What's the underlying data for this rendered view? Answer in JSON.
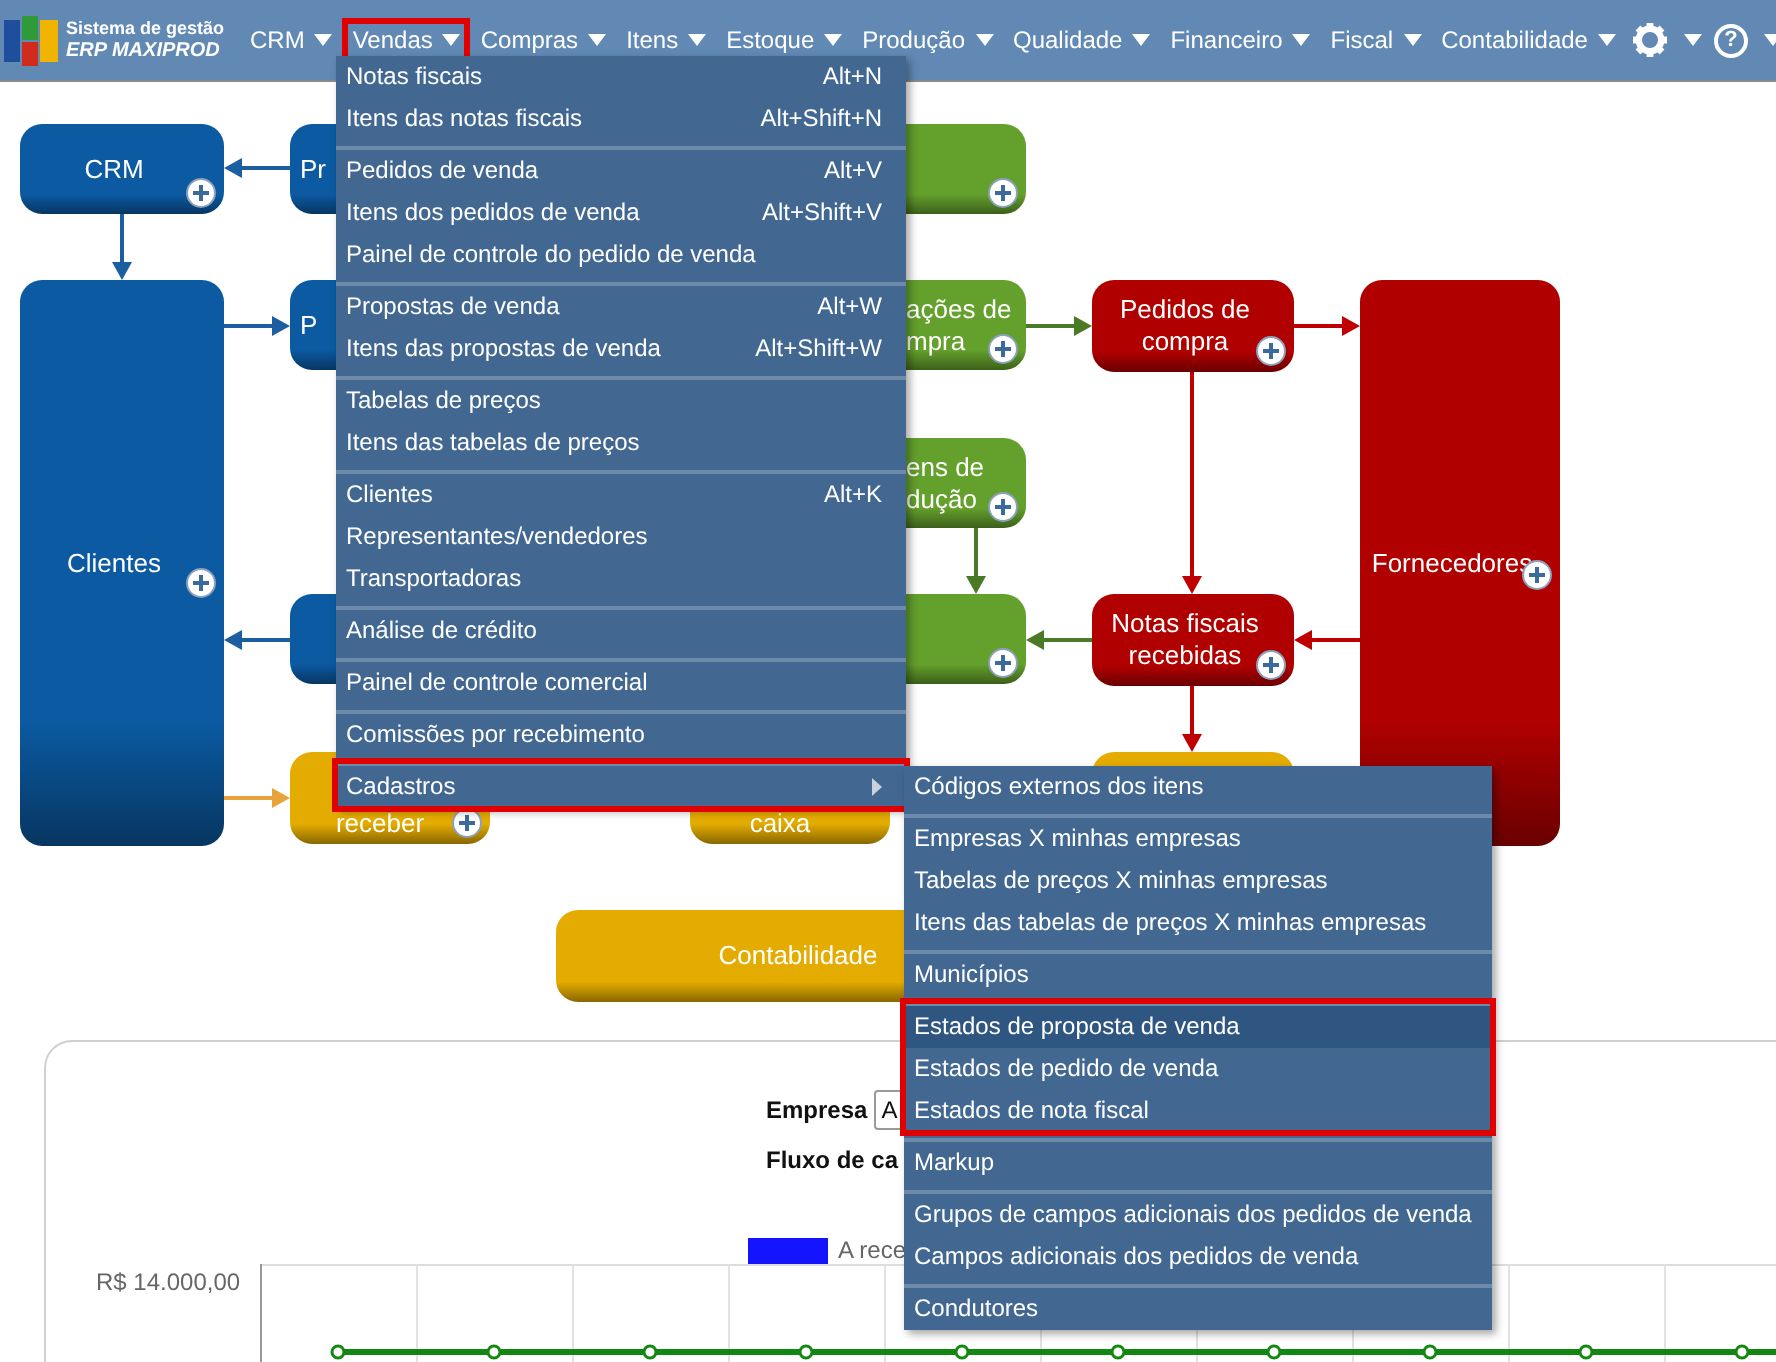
{
  "header": {
    "logo_line1": "Sistema de gestão",
    "logo_line2": "ERP MAXIPROD",
    "help_glyph": "?",
    "nav": [
      {
        "label": "CRM",
        "highlighted": false
      },
      {
        "label": "Vendas",
        "highlighted": true
      },
      {
        "label": "Compras",
        "highlighted": false
      },
      {
        "label": "Itens",
        "highlighted": false
      },
      {
        "label": "Estoque",
        "highlighted": false
      },
      {
        "label": "Produção",
        "highlighted": false
      },
      {
        "label": "Qualidade",
        "highlighted": false
      },
      {
        "label": "Financeiro",
        "highlighted": false
      },
      {
        "label": "Fiscal",
        "highlighted": false
      },
      {
        "label": "Contabilidade",
        "highlighted": false
      }
    ]
  },
  "flow_nodes": [
    {
      "lines": [
        "CRM"
      ],
      "color": "#0b5aa2",
      "has_add": true
    },
    {
      "lines": [
        "Pr"
      ],
      "color": "#0b5aa2",
      "has_add": false
    },
    {
      "color": "#64a02c",
      "has_add": true
    },
    {
      "lines": [
        "Clientes"
      ],
      "color": "#0b5aa2",
      "has_add": true
    },
    {
      "lines": [
        "P"
      ],
      "color": "#0b5aa2",
      "has_add": false
    },
    {
      "lines": [
        "ações de",
        "mpra"
      ],
      "color": "#64a02c",
      "has_add": true
    },
    {
      "lines": [
        "Pedidos de",
        "compra"
      ],
      "color": "#b00000",
      "has_add": true
    },
    {
      "lines": [
        "Fornecedores"
      ],
      "color": "#b00000",
      "has_add": true
    },
    {
      "lines": [
        "ens de",
        "dução"
      ],
      "color": "#64a02c",
      "has_add": true
    },
    {
      "color": "#0b5aa2",
      "has_add": false
    },
    {
      "color": "#64a02c",
      "has_add": true
    },
    {
      "lines": [
        "Notas fiscais",
        "recebidas"
      ],
      "color": "#b00000",
      "has_add": true
    },
    {
      "lines": [
        "receber"
      ],
      "color": "#e4ac00",
      "has_add": true
    },
    {
      "lines": [
        "caixa"
      ],
      "color": "#e4ac00",
      "has_add": false
    },
    {
      "color": "#e4ac00",
      "has_add": false
    },
    {
      "lines": [
        "Contabilidade"
      ],
      "color": "#e4ac00",
      "has_add": false
    }
  ],
  "vendas_menu": {
    "groups": [
      {
        "highlighted": false,
        "items": [
          {
            "label": "Notas fiscais",
            "shortcut": "Alt+N",
            "has_submenu": false
          },
          {
            "label": "Itens das notas fiscais",
            "shortcut": "Alt+Shift+N",
            "has_submenu": false
          }
        ]
      },
      {
        "highlighted": false,
        "items": [
          {
            "label": "Pedidos de venda",
            "shortcut": "Alt+V",
            "has_submenu": false
          },
          {
            "label": "Itens dos pedidos de venda",
            "shortcut": "Alt+Shift+V",
            "has_submenu": false
          },
          {
            "label": "Painel de controle do pedido de venda",
            "has_submenu": false
          }
        ]
      },
      {
        "highlighted": false,
        "items": [
          {
            "label": "Propostas de venda",
            "shortcut": "Alt+W",
            "has_submenu": false
          },
          {
            "label": "Itens das propostas de venda",
            "shortcut": "Alt+Shift+W",
            "has_submenu": false
          }
        ]
      },
      {
        "highlighted": false,
        "items": [
          {
            "label": "Tabelas de preços",
            "has_submenu": false
          },
          {
            "label": "Itens das tabelas de preços",
            "has_submenu": false
          }
        ]
      },
      {
        "highlighted": false,
        "items": [
          {
            "label": "Clientes",
            "shortcut": "Alt+K",
            "has_submenu": false
          },
          {
            "label": "Representantes/vendedores",
            "has_submenu": false
          },
          {
            "label": "Transportadoras",
            "has_submenu": false
          }
        ]
      },
      {
        "highlighted": false,
        "items": [
          {
            "label": "Análise de crédito",
            "has_submenu": false
          }
        ]
      },
      {
        "highlighted": false,
        "items": [
          {
            "label": "Painel de controle comercial",
            "has_submenu": false
          }
        ]
      },
      {
        "highlighted": false,
        "items": [
          {
            "label": "Comissões por recebimento",
            "has_submenu": false
          }
        ]
      },
      {
        "highlighted": true,
        "items": [
          {
            "label": "Cadastros",
            "has_submenu": true
          }
        ]
      }
    ]
  },
  "cadastros_submenu": {
    "groups": [
      {
        "highlighted": false,
        "items": [
          {
            "label": "Códigos externos dos itens",
            "hovered": false
          }
        ]
      },
      {
        "highlighted": false,
        "items": [
          {
            "label": "Empresas X minhas empresas",
            "hovered": false
          },
          {
            "label": "Tabelas de preços X minhas empresas",
            "hovered": false
          },
          {
            "label": "Itens das tabelas de preços X minhas empresas",
            "hovered": false
          }
        ]
      },
      {
        "highlighted": false,
        "items": [
          {
            "label": "Municípios",
            "hovered": false
          }
        ]
      },
      {
        "highlighted": true,
        "items": [
          {
            "label": "Estados de proposta de venda",
            "hovered": true
          },
          {
            "label": "Estados de pedido de venda",
            "hovered": false
          },
          {
            "label": "Estados de nota fiscal",
            "hovered": false
          }
        ]
      },
      {
        "highlighted": false,
        "items": [
          {
            "label": "Markup",
            "hovered": false
          }
        ]
      },
      {
        "highlighted": false,
        "items": [
          {
            "label": "Grupos de campos adicionais dos pedidos de venda",
            "hovered": false
          },
          {
            "label": "Campos adicionais dos pedidos de venda",
            "hovered": false
          }
        ]
      },
      {
        "highlighted": false,
        "items": [
          {
            "label": "Condutores",
            "hovered": false
          }
        ]
      }
    ]
  },
  "dashboard": {
    "company_label": "Empresa",
    "company_select": {
      "value": "A"
    },
    "cash_flow_label": "Fluxo de ca",
    "legend": [
      {
        "label": "A rece",
        "color": "#1414ff"
      }
    ],
    "y_tick_label": "R$ 14.000,00"
  }
}
